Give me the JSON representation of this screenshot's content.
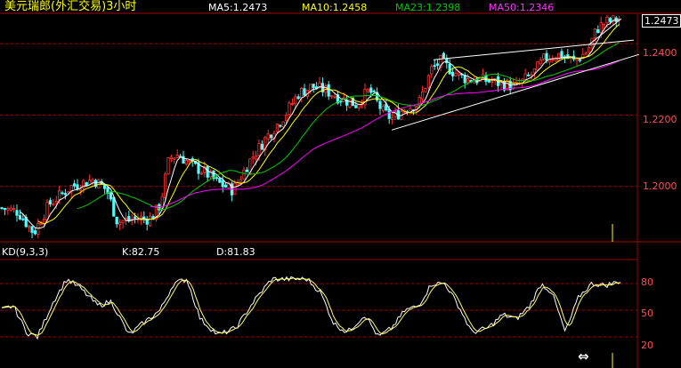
{
  "header": {
    "title": "美元瑞郎(外汇交易)3小时",
    "ma5": "MA5:1.2473",
    "ma10": "MA10:1.2458",
    "ma23": "MA23:1.2398",
    "ma50": "MA50:1.2346"
  },
  "price_axis": {
    "current_price": "1.2473",
    "ticks": [
      "1.2400",
      "1.2200",
      "1.2000"
    ]
  },
  "kd_panel": {
    "label": "KD(9,3,3)",
    "k": "K:82.75",
    "d": "D:81.83",
    "ticks": [
      "80",
      "50",
      "20"
    ]
  },
  "colors": {
    "background": "#000000",
    "up_candle": "#ff3232",
    "down_candle": "#54fcfc",
    "ma5": "#ffffff",
    "ma10": "#ffff00",
    "ma23": "#00cc00",
    "ma50": "#ff00ff",
    "grid": "#a00000",
    "title": "#ffff00",
    "k_line": "#ffffff",
    "d_line": "#ffff66"
  },
  "icons": {
    "resize": "double-arrow-horizontal-icon"
  },
  "chart_data": {
    "type": "candlestick",
    "price_ylim": [
      1.185,
      1.2485
    ],
    "kd_ylim": [
      0,
      100
    ],
    "price_pivots": [
      [
        0,
        1.194
      ],
      [
        20,
        1.193
      ],
      [
        38,
        1.187
      ],
      [
        55,
        1.195
      ],
      [
        80,
        1.2
      ],
      [
        105,
        1.202
      ],
      [
        120,
        1.199
      ],
      [
        132,
        1.19
      ],
      [
        150,
        1.191
      ],
      [
        170,
        1.191
      ],
      [
        180,
        1.195
      ],
      [
        190,
        1.208
      ],
      [
        200,
        1.209
      ],
      [
        215,
        1.206
      ],
      [
        230,
        1.204
      ],
      [
        245,
        1.201
      ],
      [
        262,
        1.199
      ],
      [
        280,
        1.207
      ],
      [
        300,
        1.214
      ],
      [
        320,
        1.22
      ],
      [
        335,
        1.226
      ],
      [
        350,
        1.228
      ],
      [
        365,
        1.227
      ],
      [
        380,
        1.225
      ],
      [
        400,
        1.223
      ],
      [
        415,
        1.227
      ],
      [
        430,
        1.221
      ],
      [
        440,
        1.219
      ],
      [
        455,
        1.222
      ],
      [
        470,
        1.223
      ],
      [
        485,
        1.233
      ],
      [
        495,
        1.235
      ],
      [
        510,
        1.232
      ],
      [
        525,
        1.23
      ],
      [
        540,
        1.23
      ],
      [
        560,
        1.229
      ],
      [
        580,
        1.228
      ],
      [
        600,
        1.232
      ],
      [
        612,
        1.236
      ],
      [
        630,
        1.237
      ],
      [
        645,
        1.235
      ],
      [
        660,
        1.238
      ],
      [
        670,
        1.244
      ],
      [
        680,
        1.246
      ],
      [
        698,
        1.247
      ]
    ],
    "kd_pivots": [
      [
        0,
        50
      ],
      [
        15,
        55
      ],
      [
        30,
        25
      ],
      [
        42,
        20
      ],
      [
        60,
        60
      ],
      [
        75,
        85
      ],
      [
        90,
        75
      ],
      [
        110,
        55
      ],
      [
        125,
        60
      ],
      [
        145,
        22
      ],
      [
        160,
        35
      ],
      [
        180,
        50
      ],
      [
        195,
        80
      ],
      [
        210,
        85
      ],
      [
        225,
        40
      ],
      [
        245,
        22
      ],
      [
        265,
        30
      ],
      [
        285,
        60
      ],
      [
        305,
        85
      ],
      [
        325,
        85
      ],
      [
        345,
        85
      ],
      [
        360,
        70
      ],
      [
        375,
        35
      ],
      [
        390,
        25
      ],
      [
        410,
        45
      ],
      [
        425,
        20
      ],
      [
        440,
        30
      ],
      [
        455,
        50
      ],
      [
        470,
        55
      ],
      [
        485,
        80
      ],
      [
        500,
        80
      ],
      [
        515,
        55
      ],
      [
        530,
        25
      ],
      [
        548,
        30
      ],
      [
        565,
        45
      ],
      [
        580,
        40
      ],
      [
        595,
        55
      ],
      [
        608,
        80
      ],
      [
        620,
        70
      ],
      [
        635,
        25
      ],
      [
        650,
        65
      ],
      [
        665,
        80
      ],
      [
        680,
        78
      ],
      [
        698,
        83
      ]
    ],
    "trendlines": [
      {
        "from": [
          487,
          1.2355
        ],
        "to": [
          712,
          1.241
        ]
      },
      {
        "from": [
          440,
          1.2158
        ],
        "to": [
          718,
          1.237
        ]
      },
      {
        "from": [
          662,
          1.2398
        ],
        "to": [
          698,
          1.247
        ]
      }
    ]
  }
}
